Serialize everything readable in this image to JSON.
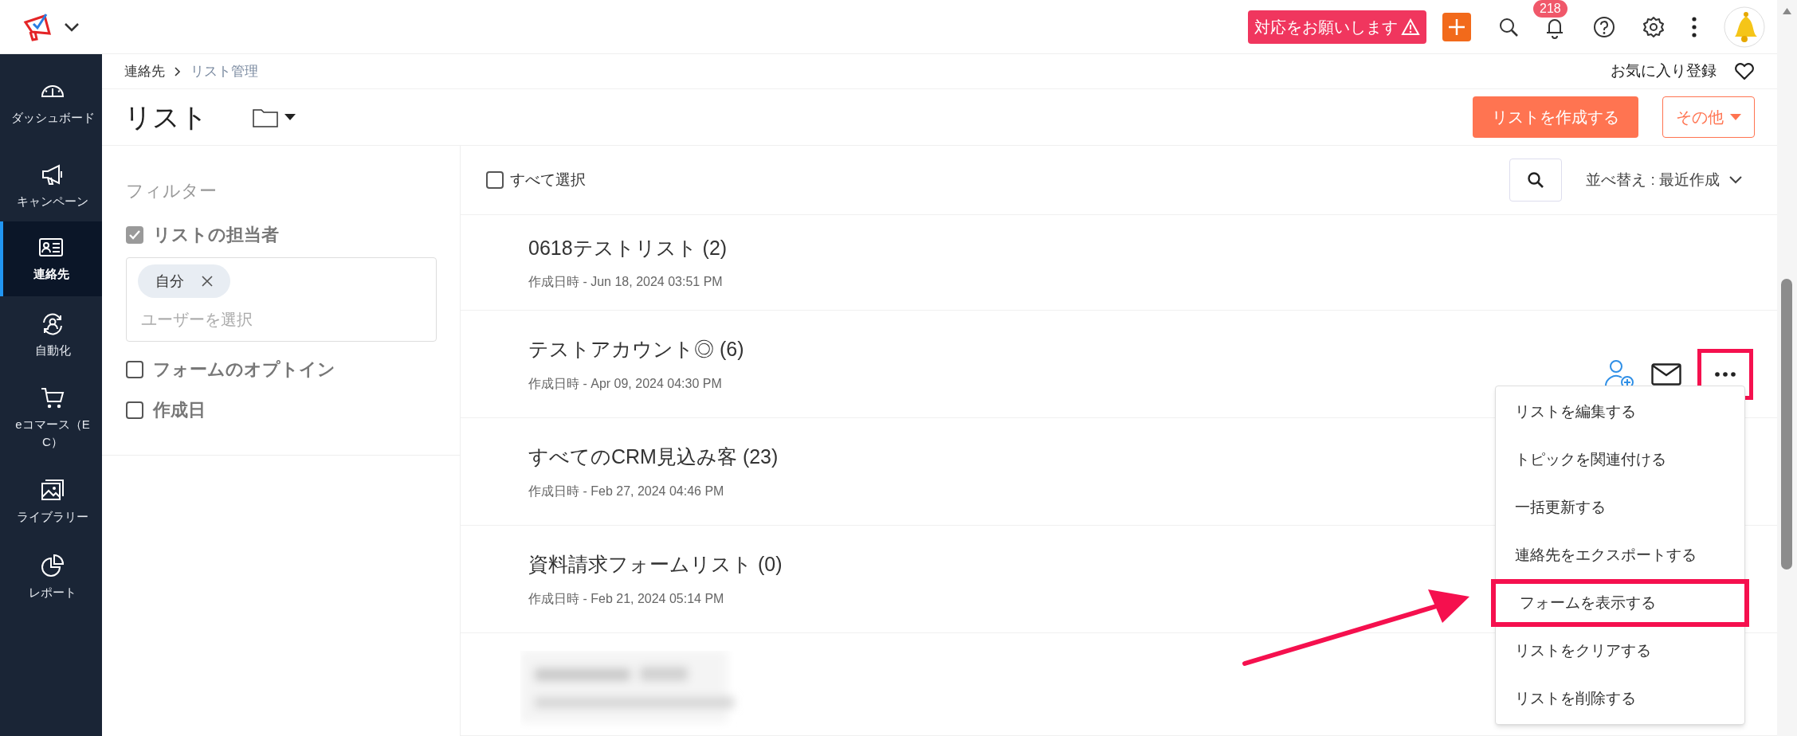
{
  "top_bar": {
    "alert_button": "対応をお願いします",
    "notification_count": "218"
  },
  "sidebar": {
    "items": [
      {
        "label": "ダッシュボード",
        "selected": false
      },
      {
        "label": "キャンペーン",
        "selected": false
      },
      {
        "label": "連絡先",
        "selected": true
      },
      {
        "label": "自動化",
        "selected": false
      },
      {
        "label": "eコマース（EC）",
        "selected": false
      },
      {
        "label": "ライブラリー",
        "selected": false
      },
      {
        "label": "レポート",
        "selected": false
      }
    ]
  },
  "breadcrumb": [
    "連絡先",
    "リスト管理"
  ],
  "favorite_label": "お気に入り登録",
  "page_title": "リスト",
  "buttons": {
    "create": "リストを作成する",
    "more": "その他"
  },
  "filter": {
    "title": "フィルター",
    "groups": [
      {
        "label": "リストの担当者",
        "checked": true
      },
      {
        "label": "フォームのオプトイン",
        "checked": false
      },
      {
        "label": "作成日",
        "checked": false
      }
    ],
    "owner_chips": [
      "自分"
    ],
    "user_placeholder": "ユーザーを選択"
  },
  "list_header": {
    "select_all": "すべて選択",
    "select_all_checked": false,
    "sort": "並べ替え : 最近作成"
  },
  "lists": [
    {
      "kind": "item",
      "name": "0618テストリスト",
      "count": "(2)",
      "created": "作成日時 - Jun 18, 2024 03:51 PM"
    },
    {
      "kind": "item",
      "name": "テストアカウント◎",
      "count": "(6)",
      "created": "作成日時 - Apr 09, 2024 04:30 PM",
      "actions_shown": true,
      "more_highlighted": true
    },
    {
      "kind": "item",
      "name": "すべてのCRM見込み客",
      "count": "(23)",
      "created": "作成日時 - Feb 27, 2024 04:46 PM"
    },
    {
      "kind": "item",
      "name": "資料請求フォームリスト",
      "count": "(0)",
      "created": "作成日時 - Feb 21, 2024 05:14 PM"
    },
    {
      "kind": "redacted"
    }
  ],
  "action_menu": {
    "items": [
      {
        "label": "リストを編集する",
        "highlighted": false
      },
      {
        "label": "トピックを関連付ける",
        "highlighted": false
      },
      {
        "label": "一括更新する",
        "highlighted": false
      },
      {
        "label": "連絡先をエクスポートする",
        "highlighted": false
      },
      {
        "label": "フォームを表示する",
        "highlighted": true
      },
      {
        "label": "リストをクリアする",
        "highlighted": false
      },
      {
        "label": "リストを削除する",
        "highlighted": false
      }
    ]
  },
  "annotation_arrow": true
}
